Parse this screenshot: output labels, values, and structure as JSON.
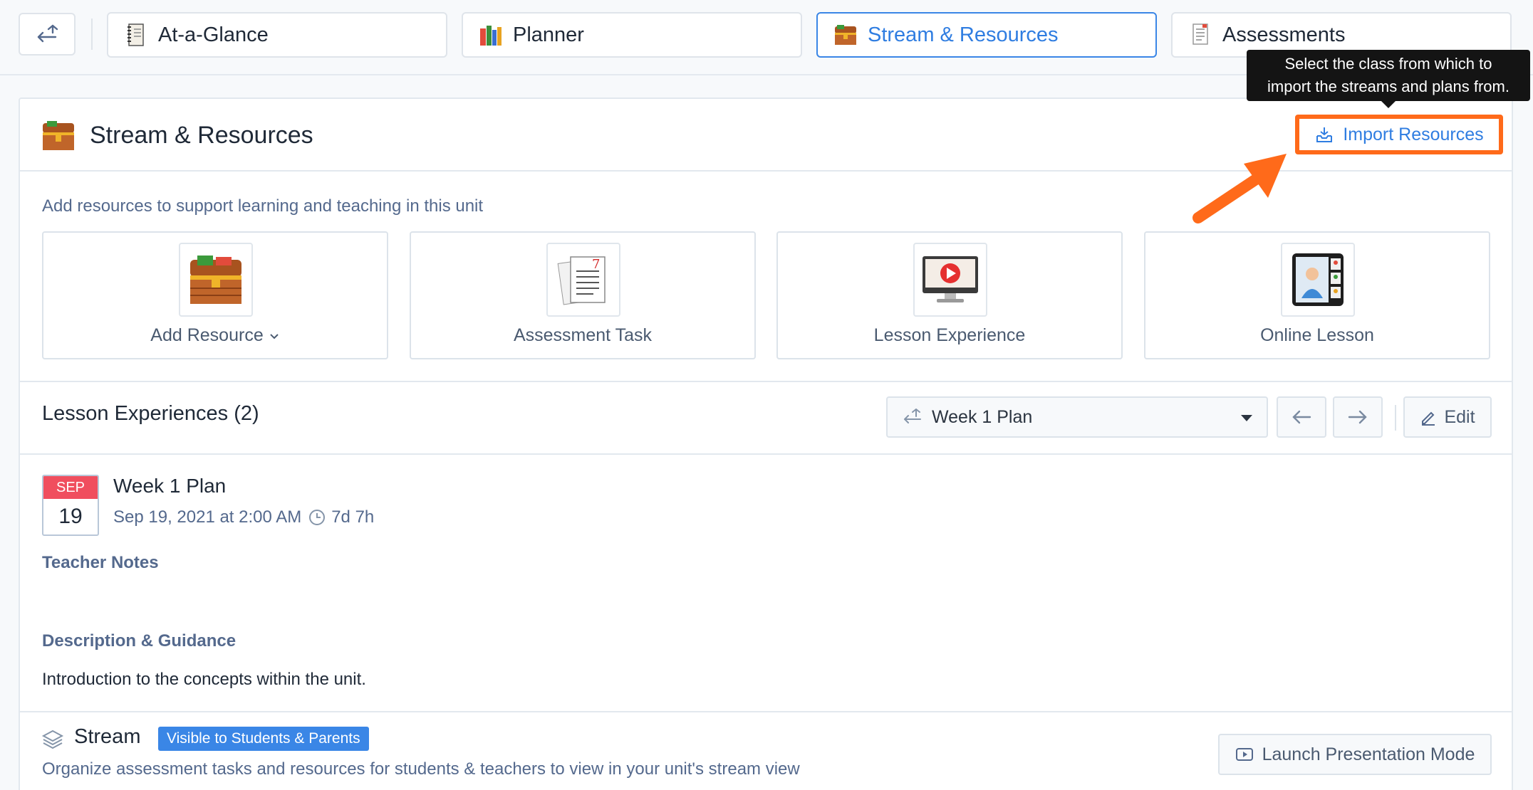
{
  "tabs": [
    {
      "label": "At-a-Glance",
      "icon": "notebook-icon"
    },
    {
      "label": "Planner",
      "icon": "books-icon"
    },
    {
      "label": "Stream & Resources",
      "icon": "treasure-chest-icon",
      "active": true
    },
    {
      "label": "Assessments",
      "icon": "document-icon"
    }
  ],
  "header": {
    "title": "Stream & Resources",
    "import_label": "Import Resources",
    "tooltip_line1": "Select the class from which to",
    "tooltip_line2": "import the streams and plans from."
  },
  "resources": {
    "subtitle": "Add resources to support learning and teaching in this unit",
    "tiles": [
      {
        "label": "Add Resource",
        "icon": "treasure-chest-icon"
      },
      {
        "label": "Assessment Task",
        "icon": "assessment-papers-icon"
      },
      {
        "label": "Lesson Experience",
        "icon": "video-monitor-icon"
      },
      {
        "label": "Online Lesson",
        "icon": "video-call-icon"
      }
    ]
  },
  "lessons": {
    "title": "Lesson Experiences (2)",
    "plan_selected": "Week 1 Plan",
    "edit_label": "Edit",
    "date_month": "SEP",
    "date_day": "19",
    "plan_name": "Week 1 Plan",
    "plan_datetime": "Sep 19, 2021 at 2:00 AM",
    "plan_duration": "7d 7h",
    "teacher_notes_label": "Teacher Notes",
    "description_label": "Description & Guidance",
    "description_text": "Introduction to the concepts within the unit."
  },
  "stream": {
    "title": "Stream",
    "visibility_badge": "Visible to Students & Parents",
    "description": "Organize assessment tasks and resources for students & teachers to view in your unit's stream view",
    "launch_label": "Launch Presentation Mode"
  },
  "colors": {
    "accent": "#2f7de1",
    "highlight": "#ff6a1a",
    "date_badge": "#f04e5e"
  }
}
